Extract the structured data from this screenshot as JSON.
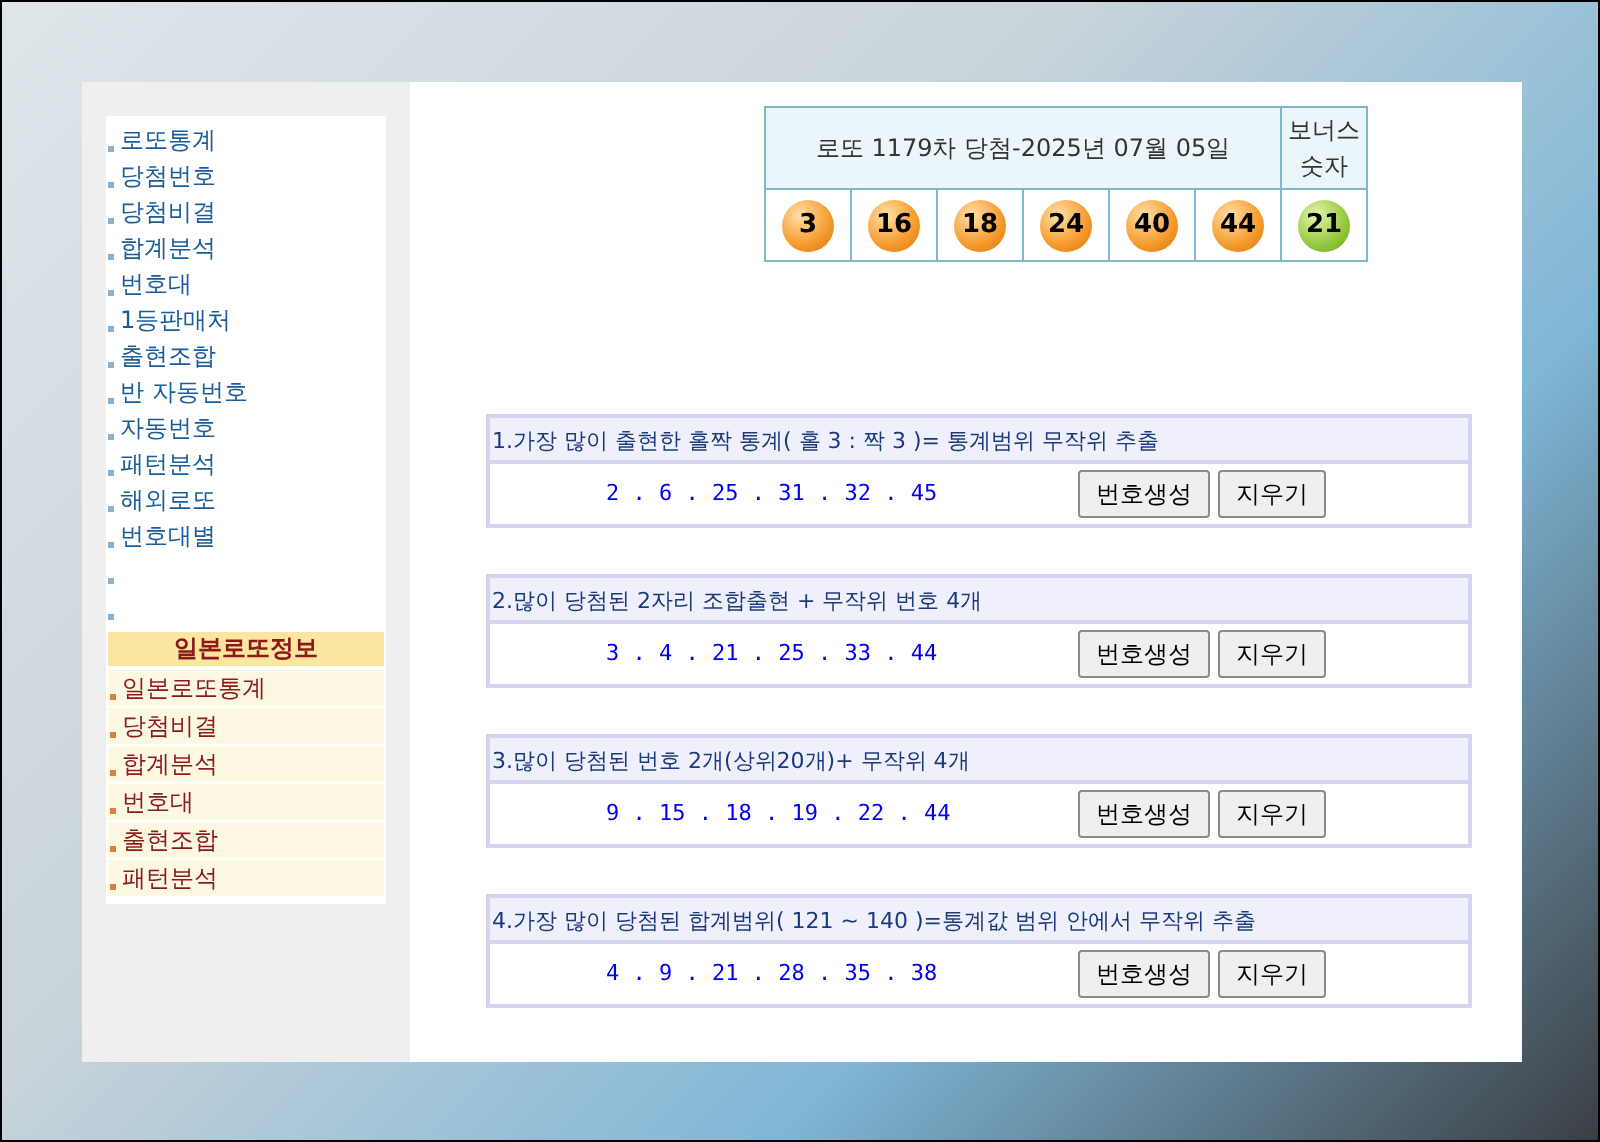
{
  "sidebar": {
    "items": [
      {
        "label": "로또통계"
      },
      {
        "label": "당첨번호"
      },
      {
        "label": "당첨비결"
      },
      {
        "label": "합계분석"
      },
      {
        "label": "번호대"
      },
      {
        "label": "1등판매처"
      },
      {
        "label": "출현조합"
      },
      {
        "label": "반 자동번호"
      },
      {
        "label": "자동번호"
      },
      {
        "label": "패턴분석"
      },
      {
        "label": "해외로또"
      },
      {
        "label": "번호대별"
      }
    ],
    "blank_bullets": [
      {
        "kind": "bullet"
      },
      {
        "kind": "bullet"
      }
    ],
    "japan": {
      "title": "일본로또정보",
      "items": [
        {
          "label": "일본로또통계"
        },
        {
          "label": "당첨비결"
        },
        {
          "label": "합계분석"
        },
        {
          "label": "번호대"
        },
        {
          "label": "출현조합"
        },
        {
          "label": "패턴분석"
        }
      ]
    }
  },
  "draw": {
    "title": "로또 1179차 당첨-2025년 07월 05일",
    "bonus_heading": "보너스 숫자",
    "balls": [
      {
        "number": "3",
        "kind": "main"
      },
      {
        "number": "16",
        "kind": "main"
      },
      {
        "number": "18",
        "kind": "main"
      },
      {
        "number": "24",
        "kind": "main"
      },
      {
        "number": "40",
        "kind": "main"
      },
      {
        "number": "44",
        "kind": "main"
      },
      {
        "number": "21",
        "kind": "bonus"
      }
    ]
  },
  "generators": [
    {
      "title": "1.가장 많이 출현한 홀짝 통계( 홀 3 : 짝 3 )= 통계범위 무작위 추출",
      "numbers": "2 . 6 . 25 . 31 . 32 . 45",
      "buttons": [
        "번호생성",
        "지우기"
      ]
    },
    {
      "title": "2.많이 당첨된 2자리 조합출현 + 무작위 번호 4개",
      "numbers": "3 . 4 . 21 . 25 . 33 . 44",
      "buttons": [
        "번호생성",
        "지우기"
      ]
    },
    {
      "title": "3.많이 당첨된 번호 2개(상위20개)+ 무작위 4개",
      "numbers": "9 . 15 . 18 . 19 . 22 . 44",
      "buttons": [
        "번호생성",
        "지우기"
      ]
    },
    {
      "title": "4.가장 많이 당첨된 합계범위( 121 ~ 140 )=통계값 범위 안에서 무작위 추출",
      "numbers": "4 . 9 . 21 . 28 . 35 . 38",
      "buttons": [
        "번호생성",
        "지우기"
      ]
    }
  ]
}
